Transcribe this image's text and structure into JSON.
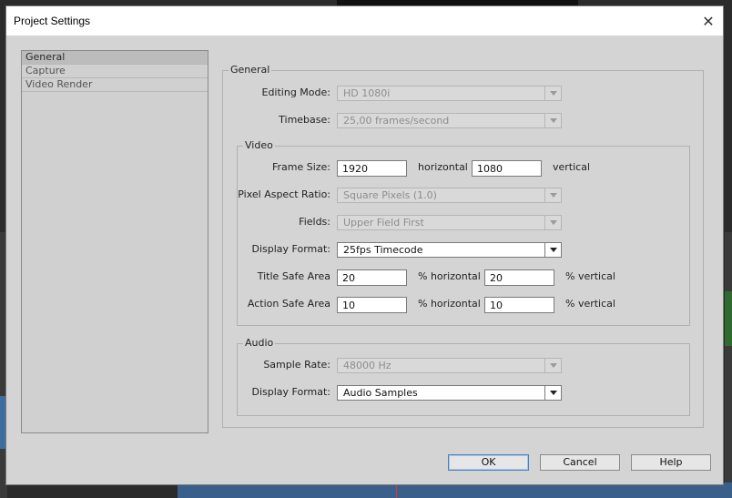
{
  "window": {
    "title": "Project Settings"
  },
  "sidebar": {
    "items": [
      {
        "label": "General",
        "selected": true
      },
      {
        "label": "Capture",
        "selected": false
      },
      {
        "label": "Video Render",
        "selected": false
      }
    ]
  },
  "general": {
    "group_label": "General",
    "editing_mode": {
      "label": "Editing Mode:",
      "value": "HD 1080i"
    },
    "timebase": {
      "label": "Timebase:",
      "value": "25,00 frames/second"
    }
  },
  "video": {
    "group_label": "Video",
    "frame_size": {
      "label": "Frame Size:",
      "horizontal": "1920",
      "horizontal_unit": "horizontal",
      "vertical": "1080",
      "vertical_unit": "vertical"
    },
    "pixel_aspect_ratio": {
      "label": "Pixel Aspect Ratio:",
      "value": "Square Pixels (1.0)"
    },
    "fields": {
      "label": "Fields:",
      "value": "Upper Field First"
    },
    "display_format": {
      "label": "Display Format:",
      "value": "25fps Timecode"
    },
    "title_safe_area": {
      "label": "Title Safe Area",
      "horizontal": "20",
      "horizontal_unit": "% horizontal",
      "vertical": "20",
      "vertical_unit": "% vertical"
    },
    "action_safe_area": {
      "label": "Action Safe Area",
      "horizontal": "10",
      "horizontal_unit": "% horizontal",
      "vertical": "10",
      "vertical_unit": "% vertical"
    }
  },
  "audio": {
    "group_label": "Audio",
    "sample_rate": {
      "label": "Sample Rate:",
      "value": "48000 Hz"
    },
    "display_format": {
      "label": "Display Format:",
      "value": "Audio Samples"
    }
  },
  "buttons": {
    "ok": "OK",
    "cancel": "Cancel",
    "help": "Help"
  }
}
